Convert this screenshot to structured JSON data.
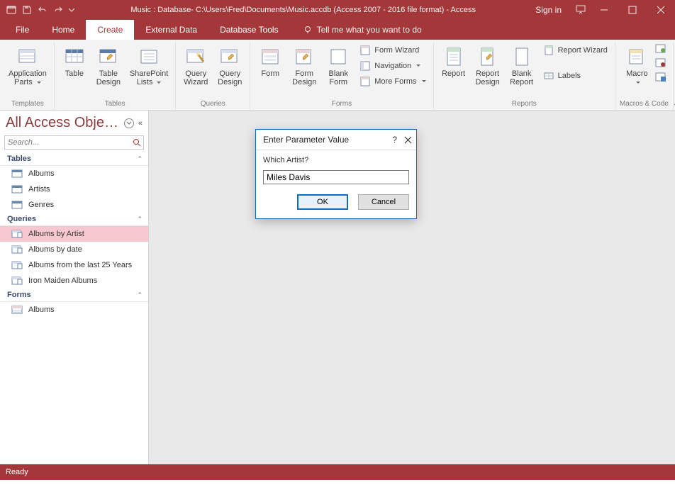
{
  "title": "Music : Database- C:\\Users\\Fred\\Documents\\Music.accdb (Access 2007 - 2016 file format) - Access",
  "signin": "Sign in",
  "tabs": {
    "file": "File",
    "home": "Home",
    "create": "Create",
    "external": "External Data",
    "dbtools": "Database Tools"
  },
  "tellme": "Tell me what you want to do",
  "ribbon": {
    "templates": {
      "name": "Templates",
      "appParts": "Application\nParts "
    },
    "tables": {
      "name": "Tables",
      "table": "Table",
      "tableDesign": "Table\nDesign",
      "sp": "SharePoint\nLists "
    },
    "queries": {
      "name": "Queries",
      "wizard": "Query\nWizard",
      "design": "Query\nDesign"
    },
    "forms": {
      "name": "Forms",
      "form": "Form",
      "formDesign": "Form\nDesign",
      "blank": "Blank\nForm",
      "formWizard": "Form Wizard",
      "navigation": "Navigation ",
      "moreForms": "More Forms "
    },
    "reports": {
      "name": "Reports",
      "report": "Report",
      "reportDesign": "Report\nDesign",
      "blank": "Blank\nReport",
      "reportWizard": "Report Wizard",
      "labels": "Labels"
    },
    "macros": {
      "name": "Macros & Code",
      "macro": "Macro"
    }
  },
  "nav": {
    "title": "All Access Obje…",
    "searchPlaceholder": "Search...",
    "cats": {
      "tables": "Tables",
      "queries": "Queries",
      "forms": "Forms"
    },
    "tables": [
      "Albums",
      "Artists",
      "Genres"
    ],
    "queries": [
      "Albums by Artist",
      "Albums by date",
      "Albums from the last 25 Years",
      "Iron Maiden Albums"
    ],
    "forms": [
      "Albums"
    ]
  },
  "dialog": {
    "title": "Enter Parameter Value",
    "prompt": "Which Artist?",
    "value": "Miles Davis",
    "ok": "OK",
    "cancel": "Cancel"
  },
  "status": "Ready"
}
